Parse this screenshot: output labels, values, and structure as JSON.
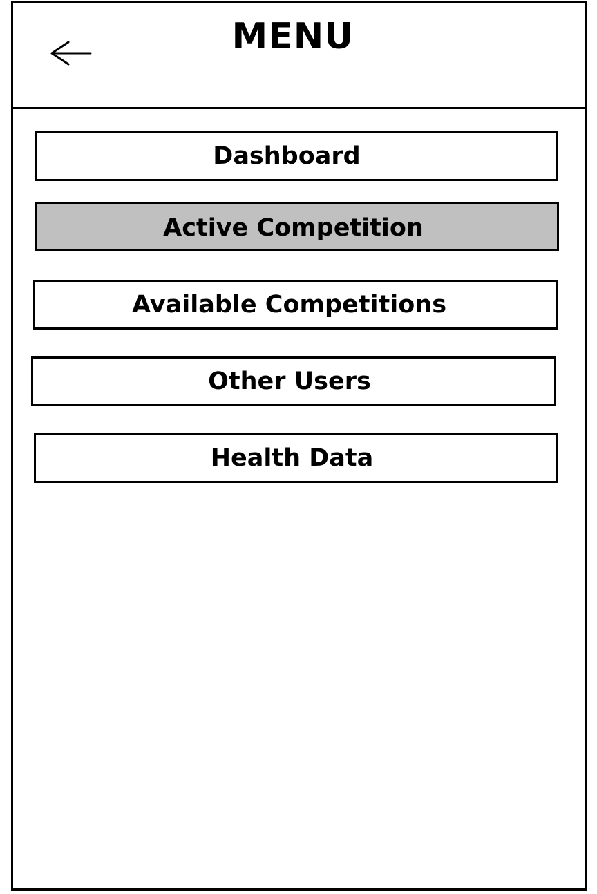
{
  "header": {
    "title": "MENU",
    "back_icon": "back-arrow-icon"
  },
  "menu": {
    "items": [
      {
        "label": "Dashboard",
        "active": false
      },
      {
        "label": "Active Competition",
        "active": true
      },
      {
        "label": "Available Competitions",
        "active": false
      },
      {
        "label": "Other Users",
        "active": false
      },
      {
        "label": "Health Data",
        "active": false
      }
    ]
  },
  "colors": {
    "border": "#000000",
    "background": "#ffffff",
    "active_item_background": "#c0c0c0"
  }
}
